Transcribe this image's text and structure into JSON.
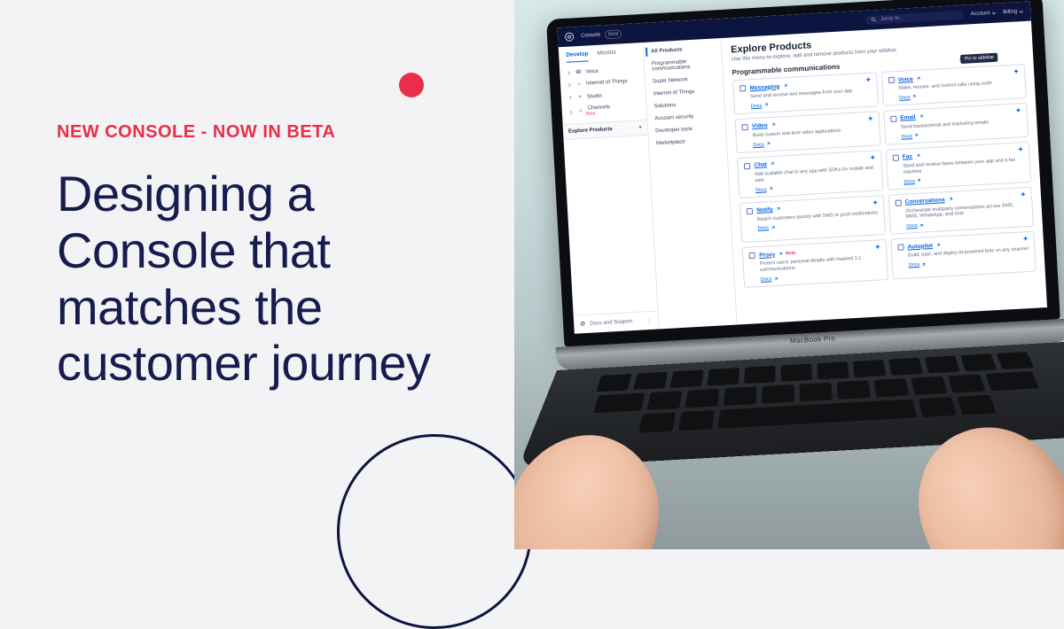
{
  "promo": {
    "eyebrow": "NEW CONSOLE - NOW IN BETA",
    "headline": "Designing a Console that matches the customer journey"
  },
  "laptop_brand": "MacBook Pro",
  "topbar": {
    "console_label": "Console",
    "beta_badge": "Beta",
    "search_placeholder": "Jump to…",
    "account_label": "Account",
    "billing_label": "Billing"
  },
  "sidebar1": {
    "tabs": {
      "develop": "Develop",
      "monitor": "Monitor"
    },
    "items": [
      {
        "label": "Voice"
      },
      {
        "label": "Internet of Things"
      },
      {
        "label": "Studio"
      },
      {
        "label": "Channels",
        "beta": "Beta"
      }
    ],
    "explore": "Explore Products",
    "footer": "Docs and Support"
  },
  "sidebar2": {
    "items": [
      "All Products",
      "Programmable communications",
      "Super Network",
      "Internet of Things",
      "Solutions",
      "Account security",
      "Developer tools",
      "Marketplace"
    ]
  },
  "main": {
    "title": "Explore Products",
    "subtitle": "Use this menu to explore, add and remove products from your sidebar.",
    "section": "Programmable communications",
    "tooltip": "Pin to sidebar",
    "docs_label": "Docs",
    "cards": [
      {
        "name": "Messaging",
        "desc": "Send and receive text messages from your app"
      },
      {
        "name": "Voice",
        "desc": "Make, receive, and control calls using code"
      },
      {
        "name": "Video",
        "desc": "Build custom real-time video applications"
      },
      {
        "name": "Email",
        "desc": "Send transactional and marketing emails"
      },
      {
        "name": "Chat",
        "desc": "Add scalable chat to any app with SDKs for mobile and web"
      },
      {
        "name": "Fax",
        "desc": "Send and receive faxes between your app and a fax machine"
      },
      {
        "name": "Notify",
        "desc": "Reach customers quickly with SMS or push notifications"
      },
      {
        "name": "Conversations",
        "desc": "Orchestrate multiparty conversations across SMS, MMS, WhatsApp, and chat"
      },
      {
        "name": "Proxy",
        "desc": "Protect users' personal details with masked 1:1 communications",
        "beta": "Beta"
      },
      {
        "name": "Autopilot",
        "desc": "Build, train, and deploy AI-powered bots on any channel"
      }
    ]
  }
}
